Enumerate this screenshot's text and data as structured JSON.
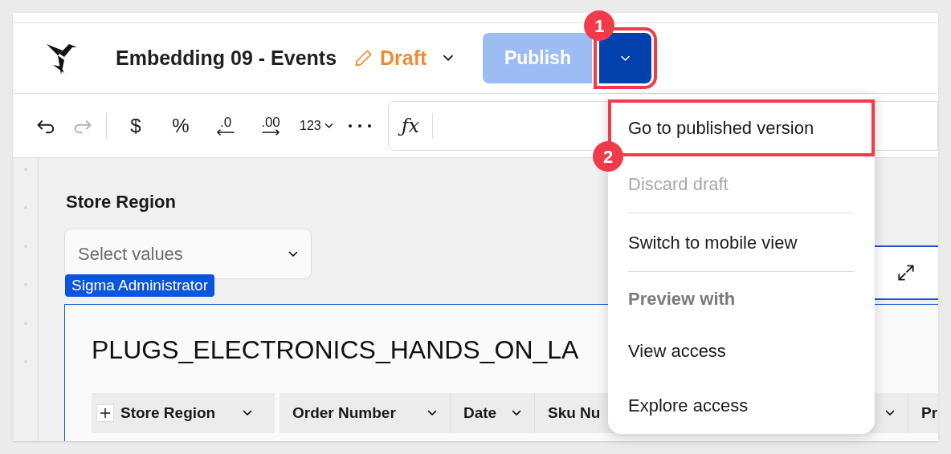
{
  "header": {
    "title": "Embedding 09 - Events",
    "status": "Draft",
    "publish_button": {
      "label": "Publish",
      "disabled": true
    },
    "publish_menu_button": {
      "callout": "1"
    }
  },
  "toolbar": {
    "items": [
      {
        "kind": "undo",
        "disabled": false
      },
      {
        "kind": "redo",
        "disabled": true
      },
      {
        "kind": "separator"
      },
      {
        "kind": "text",
        "label": "$"
      },
      {
        "kind": "text",
        "label": "%"
      },
      {
        "kind": "decimal_less",
        "label": ".0"
      },
      {
        "kind": "decimal_more",
        "label": ".00"
      },
      {
        "kind": "dropdown",
        "label": "123"
      },
      {
        "kind": "more"
      }
    ],
    "formula_label": "ƒx"
  },
  "filter": {
    "label": "Store Region",
    "placeholder": "Select values",
    "owner_tag": "Sigma Administrator"
  },
  "table": {
    "title": "PLUGS_ELECTRONICS_HANDS_ON_LA",
    "columns": [
      {
        "kind": "group",
        "label": "Store Region"
      },
      {
        "kind": "plain",
        "label": "Order Number"
      },
      {
        "kind": "plain",
        "label": "Date"
      },
      {
        "kind": "cut",
        "label": "Sku Nu"
      },
      {
        "kind": "hidden"
      },
      {
        "kind": "cut",
        "label": "Pr"
      }
    ]
  },
  "menu": {
    "items": [
      {
        "kind": "item",
        "label": "Go to published version",
        "disabled": false,
        "callout": "2"
      },
      {
        "kind": "item",
        "label": "Discard draft",
        "disabled": true
      },
      {
        "kind": "divider"
      },
      {
        "kind": "item",
        "label": "Switch to mobile view",
        "disabled": false
      },
      {
        "kind": "divider"
      },
      {
        "kind": "heading",
        "label": "Preview with"
      },
      {
        "kind": "item",
        "label": "View access",
        "disabled": false
      },
      {
        "kind": "item",
        "label": "Explore access",
        "disabled": false
      }
    ]
  }
}
